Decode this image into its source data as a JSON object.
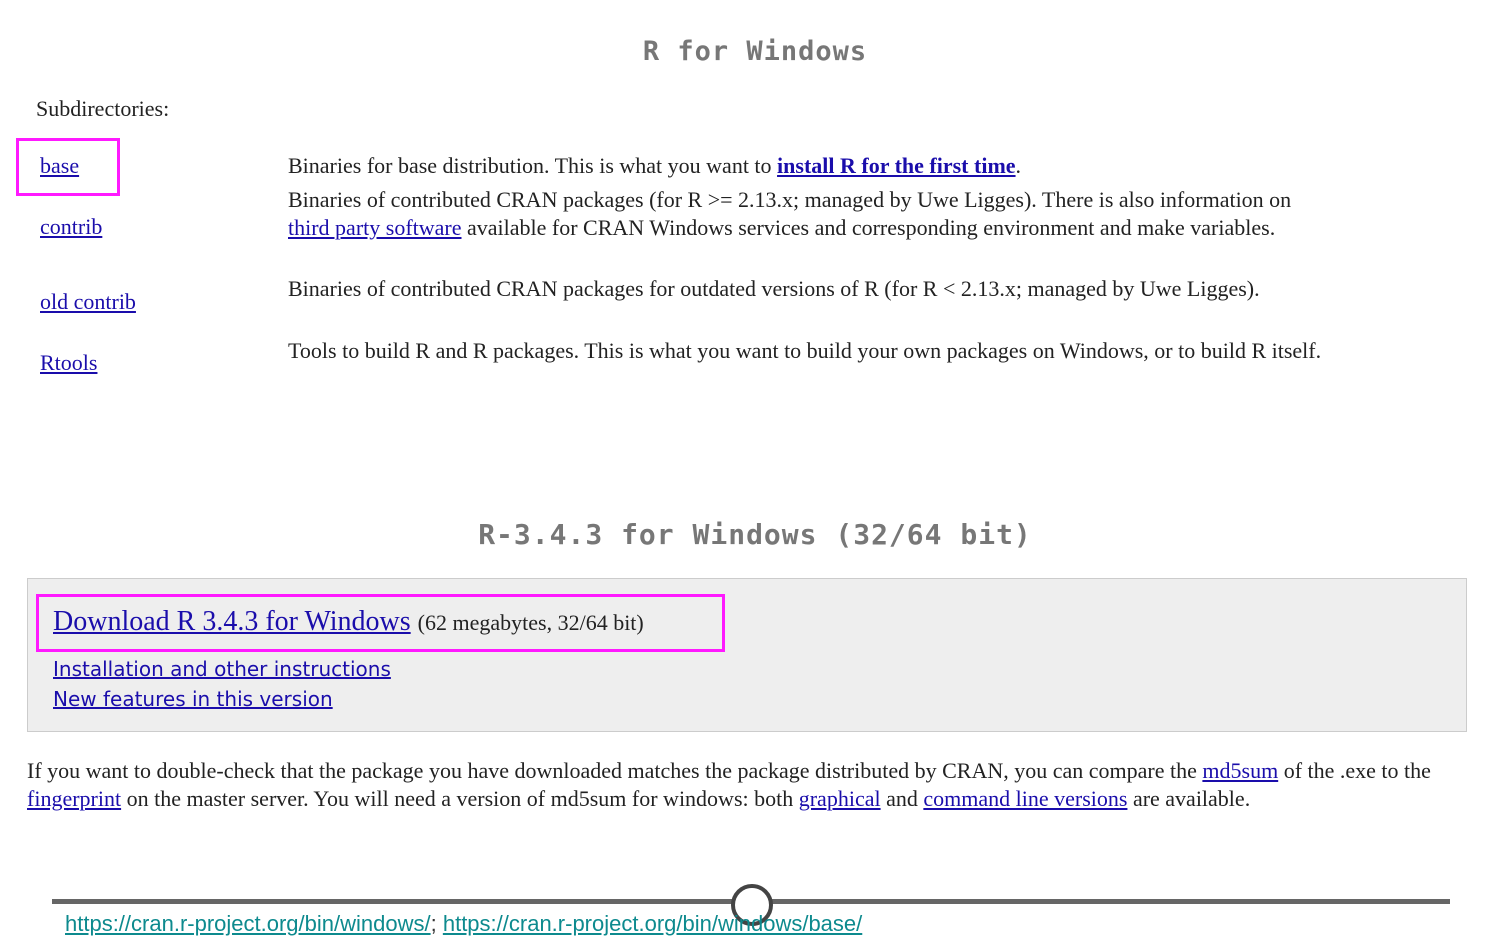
{
  "section1": {
    "title": "R for Windows",
    "subdirectories_label": "Subdirectories:",
    "items": [
      {
        "name": "base",
        "desc_before": "Binaries for base distribution. This is what you want to ",
        "desc_link": "install R for the first time",
        "desc_after": "."
      },
      {
        "name": "contrib",
        "desc_before": "Binaries of contributed CRAN packages (for R >= 2.13.x; managed by Uwe Ligges). There is also information on ",
        "desc_link": "third party software",
        "desc_after": " available for CRAN Windows services and corresponding environment and make variables."
      },
      {
        "name": "old contrib",
        "desc": "Binaries of contributed CRAN packages for outdated versions of R (for R < 2.13.x; managed by Uwe Ligges)."
      },
      {
        "name": "Rtools",
        "desc": "Tools to build R and R packages. This is what you want to build your own packages on Windows, or to build R itself."
      }
    ]
  },
  "section2": {
    "title": "R-3.4.3 for Windows (32/64 bit)",
    "download_link": "Download R 3.4.3 for Windows",
    "download_size": "(62 megabytes, 32/64 bit)",
    "install_link": "Installation and other instructions",
    "features_link": "New features in this version"
  },
  "note": {
    "part1": "If you want to double-check that the package you have downloaded matches the package distributed by CRAN, you can compare the ",
    "link_md5": "md5sum",
    "part2": " of the .exe to the ",
    "link_fingerprint": "fingerprint",
    "part3": " on the master server. You will need a version of md5sum for windows: both ",
    "link_graphical": "graphical",
    "part4": " and ",
    "link_cmdline": "command line versions",
    "part5": " are available."
  },
  "footer": {
    "url1": "https://cran.r-project.org/bin/windows/",
    "sep": "; ",
    "url2": "https://cran.r-project.org/bin/windows/base/"
  },
  "colors": {
    "highlight": "#ff19ff",
    "link": "#1a0dab",
    "title_gray": "#777777",
    "panel_bg": "#eeeeee",
    "footer_link": "#0d8a8e"
  }
}
